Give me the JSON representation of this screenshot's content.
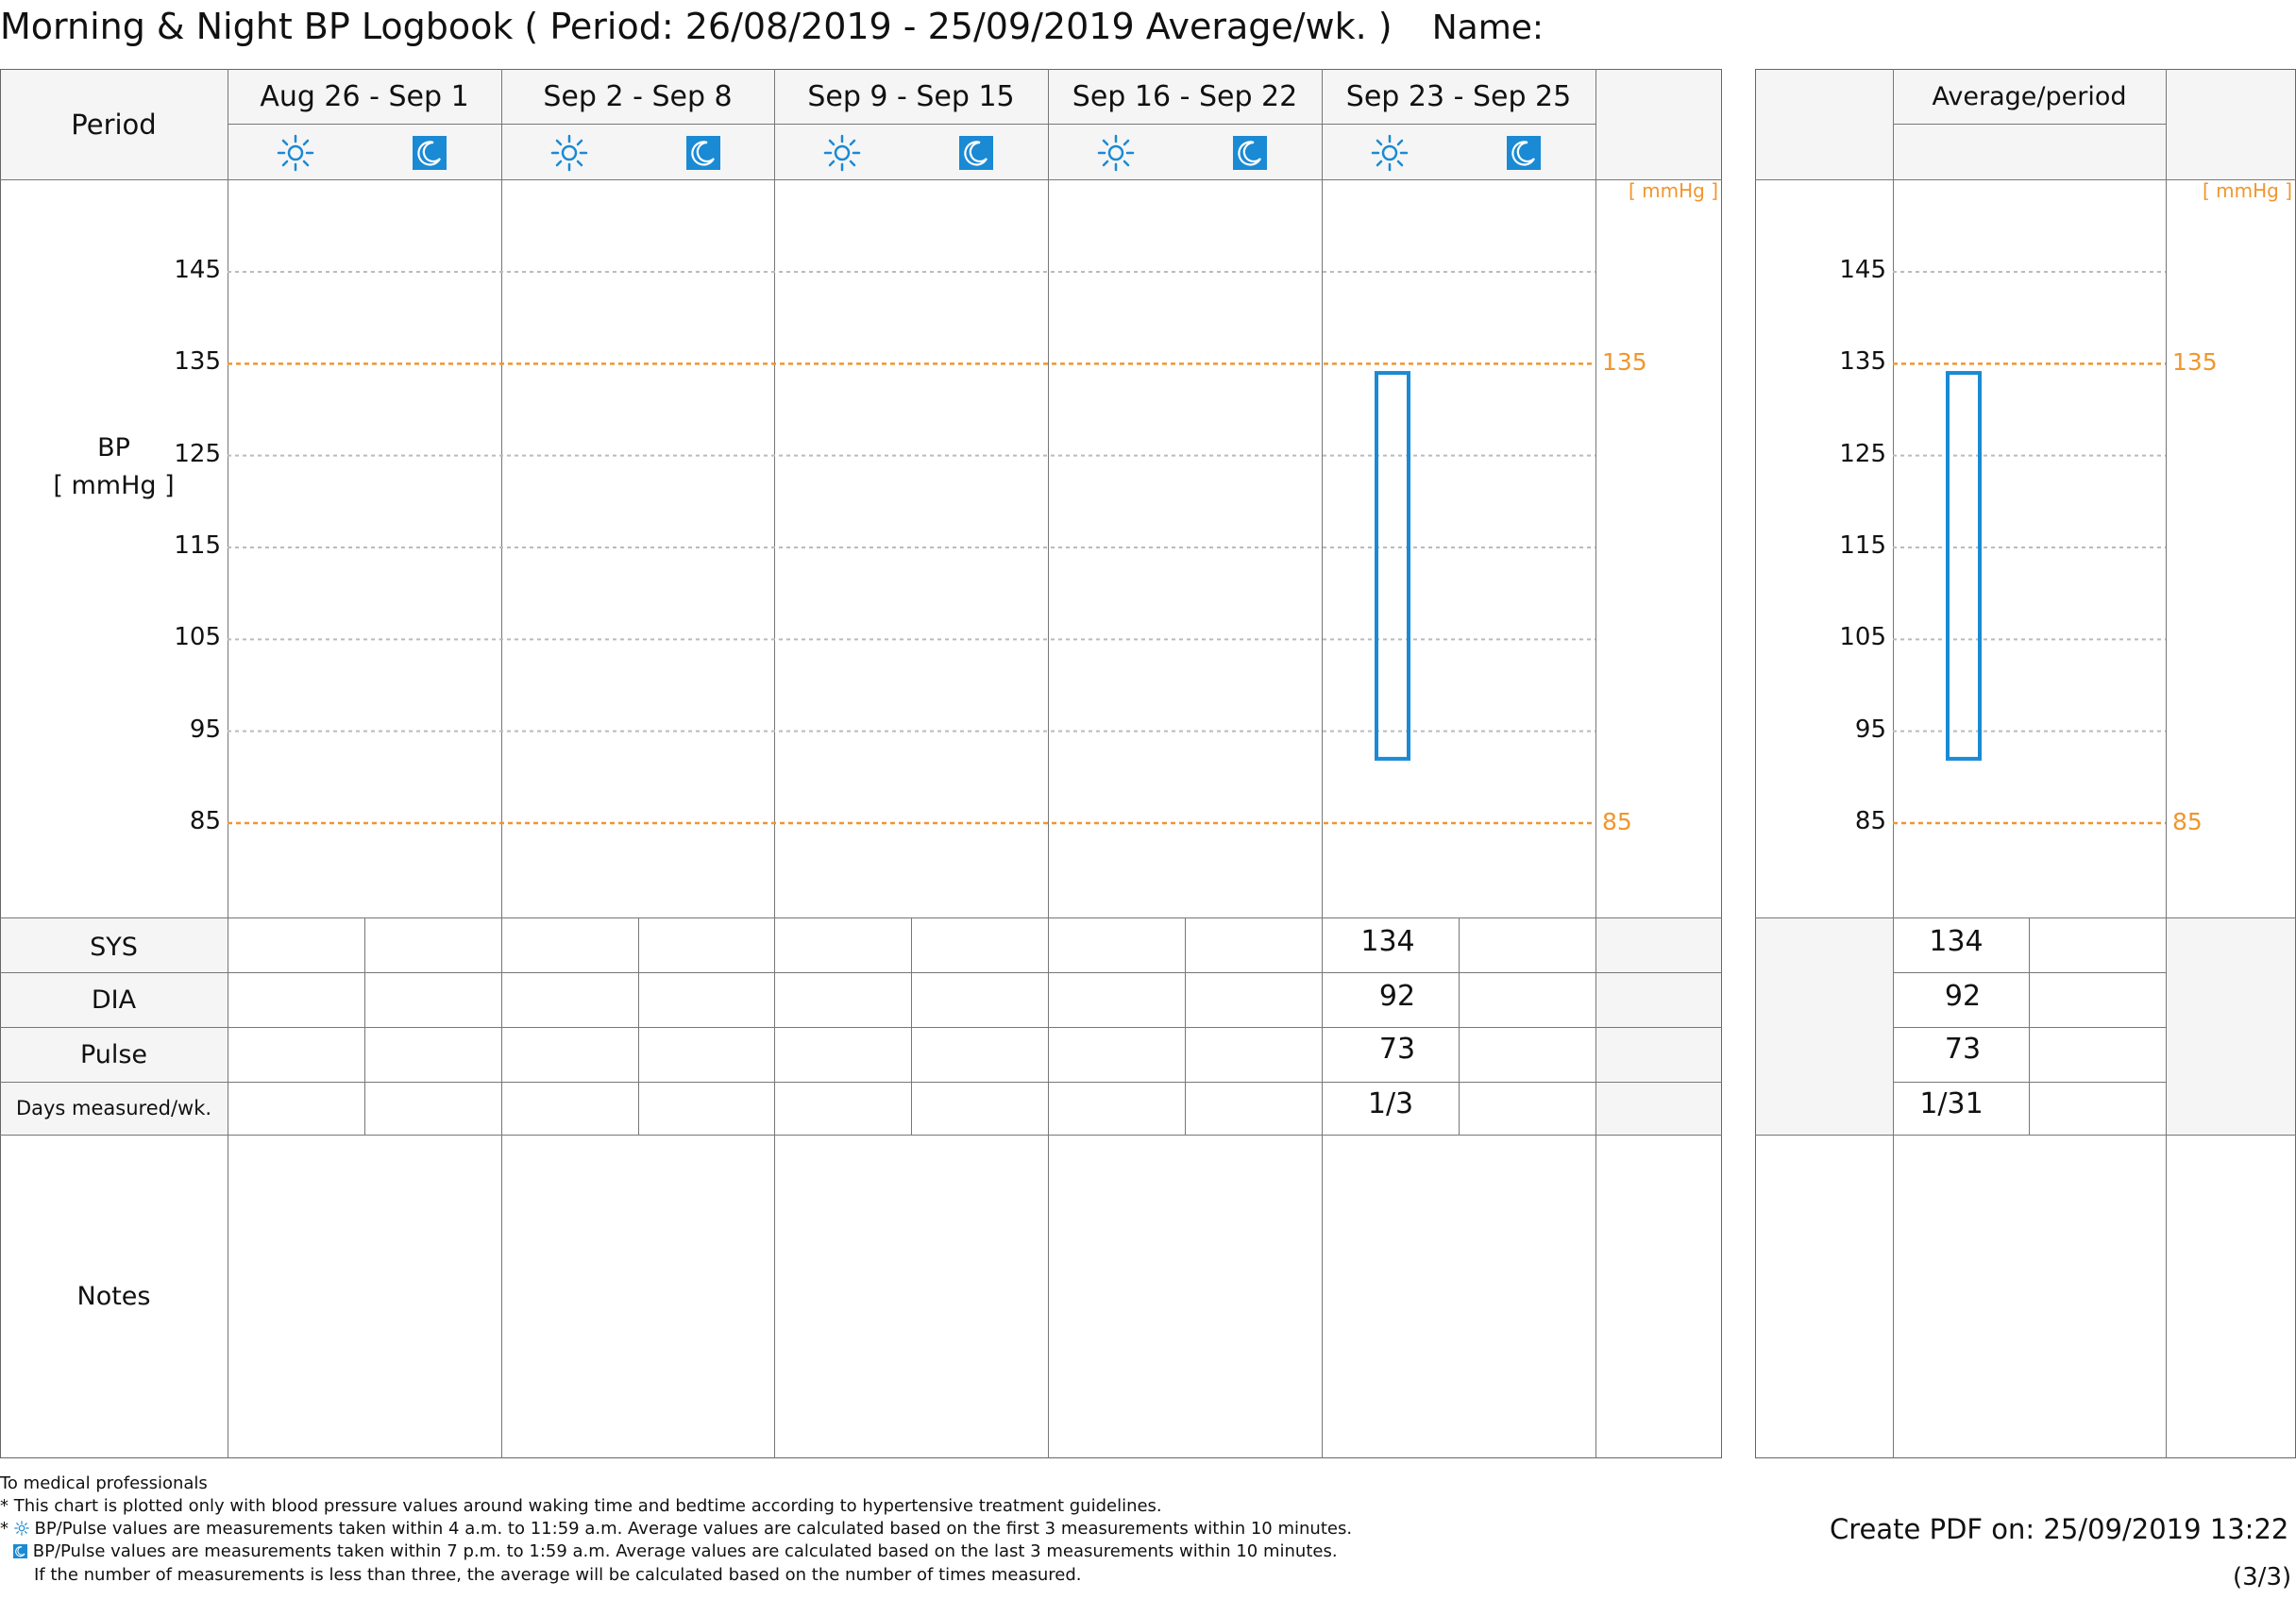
{
  "header": {
    "title": "Morning & Night BP Logbook ( Period: 26/08/2019 - 25/09/2019 Average/wk. )",
    "name_label": "Name:"
  },
  "table": {
    "period_label": "Period",
    "periods": [
      "Aug 26 - Sep 1",
      "Sep 2 - Sep 8",
      "Sep 9 - Sep 15",
      "Sep 16 - Sep 22",
      "Sep 23 - Sep 25"
    ],
    "avg_label": "Average/period",
    "bp_label_line1": "BP",
    "bp_label_line2": "[ mmHg ]",
    "unit_label": "[ mmHg ]",
    "rows": [
      "SYS",
      "DIA",
      "Pulse",
      "Days measured/wk."
    ],
    "notes_label": "Notes",
    "values": {
      "sys": "134",
      "dia": "92",
      "pulse": "73",
      "days": "1/3"
    },
    "avg_values": {
      "sys": "134",
      "dia": "92",
      "pulse": "73",
      "days": "1/31"
    }
  },
  "icons": {
    "morning": "sun-icon",
    "night": "moon-icon"
  },
  "colors": {
    "accent": "#1a8ad4",
    "reference": "#f0962d",
    "grid": "#bbbbbb",
    "header_bg": "#f5f5f5"
  },
  "chart_data": {
    "type": "bar",
    "categories": [
      "Aug 26 - Sep 1",
      "Sep 2 - Sep 8",
      "Sep 9 - Sep 15",
      "Sep 16 - Sep 22",
      "Sep 23 - Sep 25"
    ],
    "series": [
      {
        "name": "",
        "slot": "morning",
        "ranges": [
          null,
          null,
          null,
          null,
          [
            92,
            134
          ]
        ]
      },
      {
        "name": "",
        "slot": "night",
        "ranges": [
          null,
          null,
          null,
          null,
          null
        ]
      }
    ],
    "average": {
      "morning": [
        92,
        134
      ],
      "night": null
    },
    "yticks": [
      145,
      135,
      125,
      115,
      105,
      95,
      85
    ],
    "reference_lines": [
      135,
      85
    ],
    "ylim": [
      75,
      155
    ],
    "ylabel": "BP [ mmHg ]"
  },
  "footer": {
    "line1": "To medical professionals",
    "line2": "* This chart is plotted only with blood pressure values around waking time and bedtime according to hypertensive treatment guidelines.",
    "line3": "BP/Pulse values are measurements taken within 4 a.m. to 11:59 a.m. Average values are calculated based on the first 3 measurements within 10 minutes.",
    "line4": "BP/Pulse values are measurements taken within 7 p.m. to 1:59 a.m. Average values are calculated based on the last 3 measurements within 10 minutes.",
    "line5": "If the number of measurements is less than three, the average will be calculated based on the number of times measured.",
    "created": "Create PDF on: 25/09/2019 13:22",
    "page": "(3/3)"
  }
}
